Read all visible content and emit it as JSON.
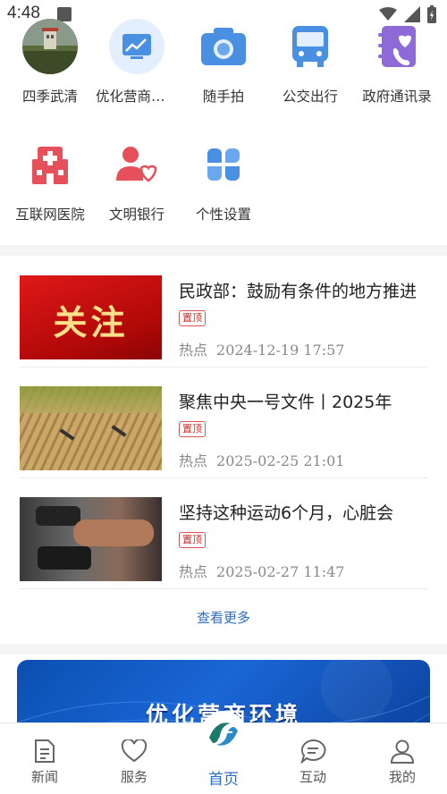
{
  "status_bar": {
    "time": "4:48"
  },
  "shortcuts": [
    {
      "label": "四季武清",
      "icon": "tower-photo-icon"
    },
    {
      "label": "优化营商环境",
      "icon": "chart-board-icon"
    },
    {
      "label": "随手拍",
      "icon": "camera-icon"
    },
    {
      "label": "公交出行",
      "icon": "bus-icon"
    },
    {
      "label": "政府通讯录",
      "icon": "contact-book-icon"
    },
    {
      "label": "互联网医院",
      "icon": "hospital-icon"
    },
    {
      "label": "文明银行",
      "icon": "user-heart-icon"
    },
    {
      "label": "个性设置",
      "icon": "four-petal-icon"
    }
  ],
  "news": [
    {
      "title": "民政部：鼓励有条件的地方推进",
      "tag": "置顶",
      "category": "热点",
      "time": "2024-12-19 17:57",
      "thumb_text": "关注"
    },
    {
      "title": "聚焦中央一号文件丨2025年",
      "tag": "置顶",
      "category": "热点",
      "time": "2025-02-25 21:01",
      "thumb_text": ""
    },
    {
      "title": "坚持这种运动6个月，心脏会",
      "tag": "置顶",
      "category": "热点",
      "time": "2025-02-27 11:47",
      "thumb_text": ""
    }
  ],
  "more_label": "查看更多",
  "banner": {
    "title": "优化营商环境"
  },
  "bottom_nav": [
    {
      "label": "新闻",
      "icon": "news-doc-icon"
    },
    {
      "label": "服务",
      "icon": "heart-outline-icon"
    },
    {
      "label": "首页",
      "icon": "home-logo-icon"
    },
    {
      "label": "互动",
      "icon": "chat-bubble-icon"
    },
    {
      "label": "我的",
      "icon": "person-icon"
    }
  ],
  "colors": {
    "accent": "#2b6cc4",
    "icon_blue": "#4a90e2",
    "icon_red": "#e5505a",
    "tag_red": "#c9302c"
  }
}
